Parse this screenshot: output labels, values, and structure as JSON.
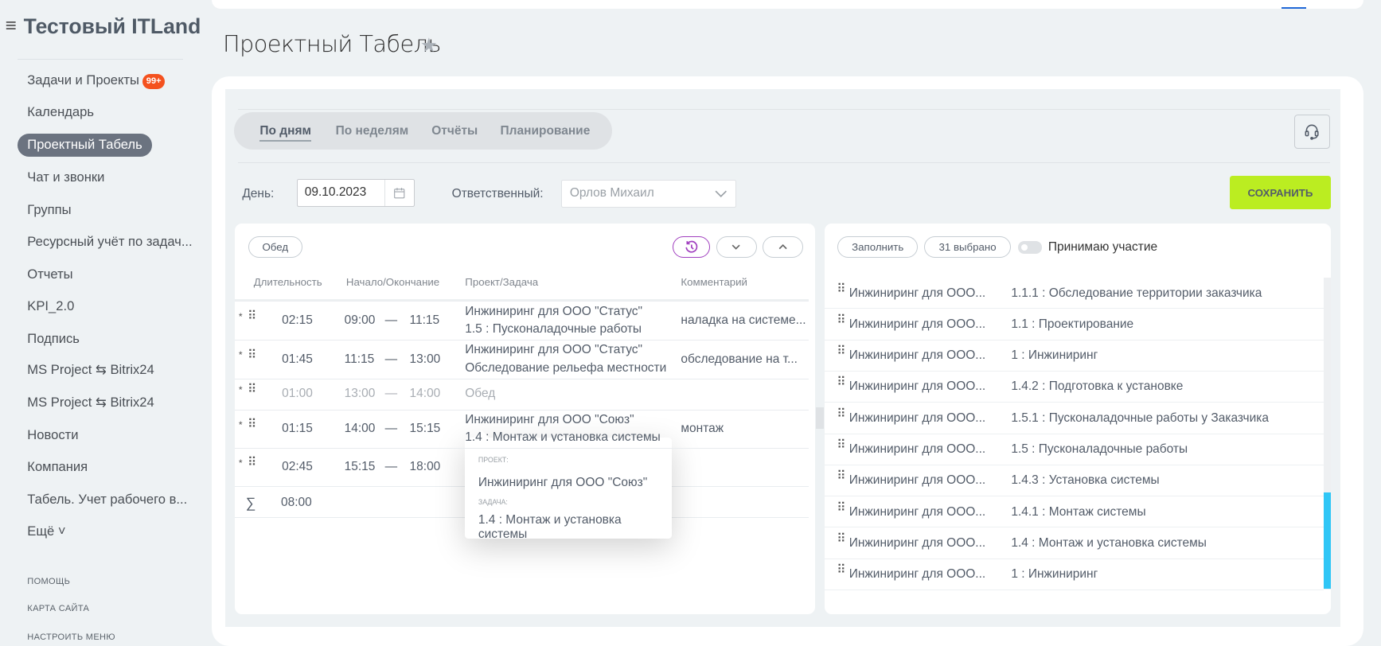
{
  "sidebar": {
    "company": "Тестовый ITLand",
    "company_fade": "",
    "items": [
      {
        "label": "Задачи и Проекты",
        "badge": "99+"
      },
      {
        "label": "Календарь"
      },
      {
        "label": "Проектный Табель",
        "active": true
      },
      {
        "label": "Чат и звонки"
      },
      {
        "label": "Группы"
      },
      {
        "label": "Ресурсный учёт по задач..."
      },
      {
        "label": "Отчеты"
      },
      {
        "label": "KPI_2.0"
      },
      {
        "label": "Подпись"
      },
      {
        "label": "MS Project ⇆ Bitrix24"
      },
      {
        "label": "MS Project ⇆ Bitrix24"
      },
      {
        "label": "Новости"
      },
      {
        "label": "Компания"
      },
      {
        "label": "Табель. Учет рабочего в..."
      },
      {
        "label": "Ещё ˅"
      }
    ],
    "footer": [
      "ПОМОЩЬ",
      "КАРТА САЙТА",
      "НАСТРОИТЬ МЕНЮ"
    ]
  },
  "page": {
    "title": "Проектный Табель"
  },
  "tabs": [
    "По дням",
    "По неделям",
    "Отчёты",
    "Планирование"
  ],
  "filters": {
    "day_label": "День:",
    "day_value": "09.10.2023",
    "responsible_label": "Ответственный:",
    "responsible_value": "Орлов Михаил",
    "save": "СОХРАНИТЬ"
  },
  "left": {
    "lunch_button": "Обед",
    "headers": [
      "Длительность",
      "Начало/Окончание",
      "Проект/Задача",
      "Комментарий"
    ],
    "dash": "—",
    "rows": [
      {
        "dur": "02:15",
        "start": "09:00",
        "end": "11:15",
        "project": "Инжиниринг для ООО \"Статус\"",
        "task": "1.5 : Пусконаладочные работы",
        "comment": "наладка на системе..."
      },
      {
        "dur": "01:45",
        "start": "11:15",
        "end": "13:00",
        "project": "Инжиниринг для ООО \"Статус\"",
        "task": "Обследование рельефа местности",
        "comment": "обследование на т..."
      },
      {
        "dur": "01:00",
        "start": "13:00",
        "end": "14:00",
        "project": "Обед",
        "task": "",
        "comment": "",
        "muted": true
      },
      {
        "dur": "01:15",
        "start": "14:00",
        "end": "15:15",
        "project": "Инжиниринг для ООО \"Союз\"",
        "task": "1.4 : Монтаж и установка системы",
        "comment": "монтаж"
      },
      {
        "dur": "02:45",
        "start": "15:15",
        "end": "18:00",
        "project": "",
        "task": "",
        "comment": ""
      }
    ],
    "sum_symbol": "∑",
    "total": "08:00"
  },
  "tooltip": {
    "project_label": "ПРОЕКТ:",
    "project": "Инжиниринг для ООО \"Союз\"",
    "task_label": "ЗАДАЧА:",
    "task": "1.4 : Монтаж и установка системы"
  },
  "right": {
    "fill": "Заполнить",
    "selected": "31 выбрано",
    "participate": "Принимаю участие",
    "participate_on": false,
    "rows": [
      {
        "project": "Инжиниринг для ООО...",
        "task": "1.1.1 : Обследование территории заказчика"
      },
      {
        "project": "Инжиниринг для ООО...",
        "task": "1.1 : Проектирование"
      },
      {
        "project": "Инжиниринг для ООО...",
        "task": "1 : Инжиниринг"
      },
      {
        "project": "Инжиниринг для ООО...",
        "task": "1.4.2 : Подготовка к установке"
      },
      {
        "project": "Инжиниринг для ООО...",
        "task": "1.5.1 : Пусконаладочные работы у Заказчика"
      },
      {
        "project": "Инжиниринг для ООО...",
        "task": "1.5 : Пусконаладочные работы"
      },
      {
        "project": "Инжиниринг для ООО...",
        "task": "1.4.3 : Установка системы"
      },
      {
        "project": "Инжиниринг для ООО...",
        "task": "1.4.1 : Монтаж системы"
      },
      {
        "project": "Инжиниринг для ООО...",
        "task": "1.4 : Монтаж и установка системы"
      },
      {
        "project": "Инжиниринг для ООО...",
        "task": "1 : Инжиниринг"
      }
    ]
  },
  "colors": {
    "accent": "#bbed21",
    "badge": "#f4511e",
    "scroll": "#2fc6f6",
    "history": "#a03fbf"
  }
}
